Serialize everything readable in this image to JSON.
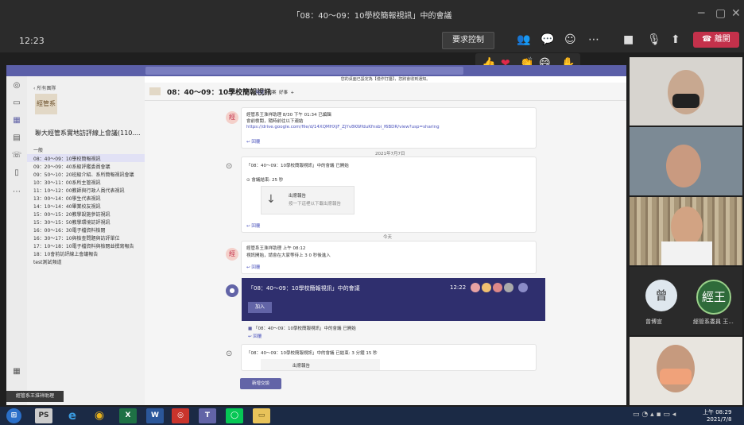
{
  "window": {
    "title": "「08：40～09：10學校簡報視訊」中的會議"
  },
  "meeting": {
    "time": "12:23",
    "request_control": "要求控制",
    "leave": "離開"
  },
  "shared": {
    "channel_title": "08：40～09：10學校簡報視訊",
    "channel_tabs": [
      "貼文",
      "檔案",
      "好事"
    ],
    "back": "所有團隊",
    "team_logo": "經管系",
    "team_name": "聯大經管系實地訪評線上會議(110....",
    "section": "一般",
    "channels": [
      "08：40～09：10學校簡報視訊",
      "09：20～09：40系級評鑑委員會議",
      "09：50～10：20班級介紹、系所簡報視訊會議",
      "10：30～11：00系所主管視訊",
      "11：10～12：00教師與行政人員代表視訊",
      "13：00～14：00學生代表視訊",
      "14：10～14：40畢業校友視訊",
      "15：00～15：20教學設施參訪視訊",
      "15：30～15：50教學環境訪評視訊",
      "16：00～16：30電子檔資料檢閱",
      "16：30～17：10與檢查問題與訪評單位",
      "17：10～18：10電子檔資料與檢閱並撰寫報告",
      "18：10會前訪評線上會議報告",
      "test測試頻道"
    ],
    "banner": "您的桌面已設定為【僅作打擾】，您將會收到通知。",
    "post1_author": "經管系王淮祥助理  8/30 下午 01:34  已編輯",
    "post1_text": "會前檢閱，隨時前往以下連結",
    "post1_link": "https://drive.google.com/file/d/14XQMHXjF_ZjYv8KWfduKfnsbi_f6BDR/view?usp=sharing",
    "reply": "回覆",
    "date1": "2021年7月7日",
    "post2_title": "「08：40～09：10學校簡報視訊」中的會議 已開始",
    "post2_sub": "會議結束: 25 秒",
    "file_title": "出席報告",
    "file_sub": "按一下這裡以下載出席報告",
    "date2": "今天",
    "post3_author": "經管系王淮祥助理  上午 08:12",
    "post3_text": "視訊開始，請會在大家等待上 3 0 秒後進入",
    "meet_title": "「08：40～09：10學校簡報視訊」中的會議",
    "meet_time": "12:22",
    "join": "加入",
    "meet_started": "「08：40～09：10學校簡報視訊」中的會議 已開始",
    "post4_title": "「08：40～09：10學校簡報視訊」中的會議 已結束: 3 分鐘 15 秒",
    "post4_file": "出席報告",
    "new_post": "新增交談",
    "presenter": "經管系王淮祥助理"
  },
  "participants": [
    {
      "initial": "曾",
      "name": "曾博宣"
    },
    {
      "initial": "經王",
      "name": "經管系委員 王..."
    }
  ],
  "taskbar": {
    "time": "上午 08:29",
    "date": "2021/7/8"
  },
  "colors": {
    "accent": "#6264a7",
    "leave": "#c4314b",
    "taskbar": "#1b2a45"
  }
}
